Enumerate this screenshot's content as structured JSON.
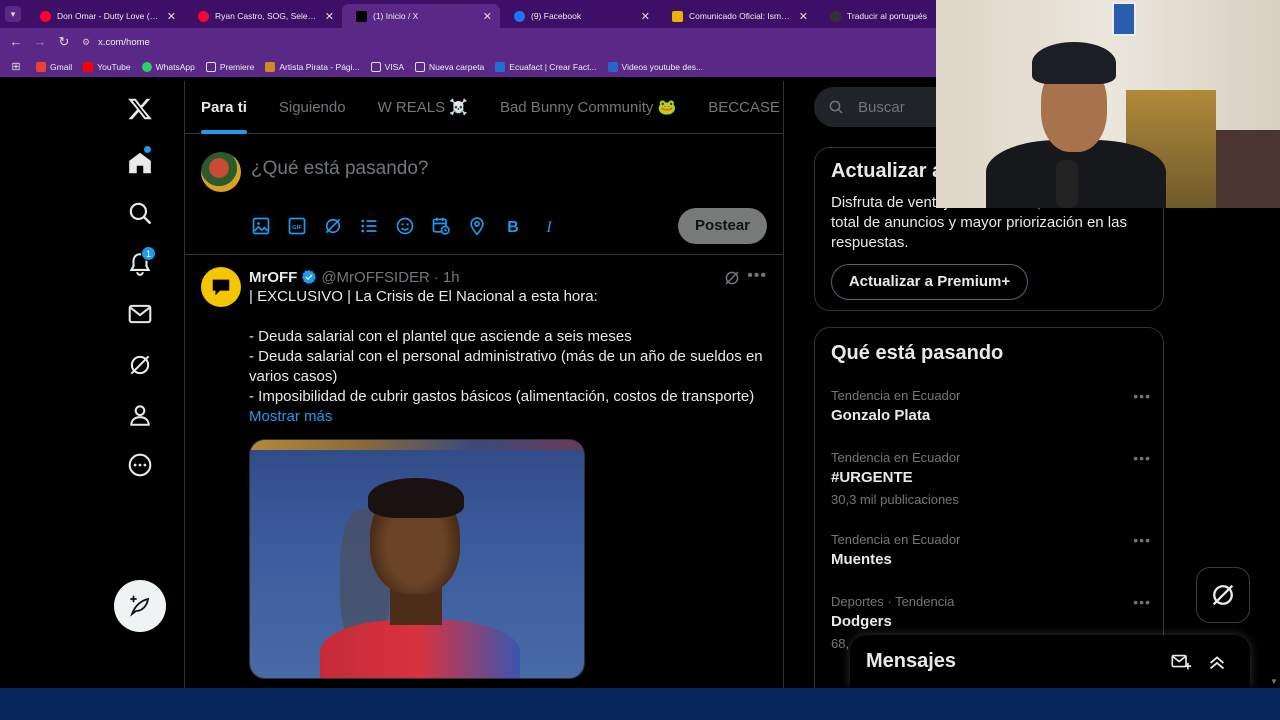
{
  "browser": {
    "tabs": [
      {
        "title": "Don Omar - Dutty Love (Lyric V",
        "favicon_color": "#ff0033",
        "active": false
      },
      {
        "title": "Ryan Castro, SOG, Selección Co",
        "favicon_color": "#ff0033",
        "active": false
      },
      {
        "title": "(1) Inicio / X",
        "favicon_color": "#000000",
        "active": true
      },
      {
        "title": "(9) Facebook",
        "favicon_color": "#1877f2",
        "active": false
      },
      {
        "title": "Comunicado Oficial: Ismael Re",
        "favicon_color": "#e8b400",
        "active": false
      },
      {
        "title": "Traducir al portugués",
        "favicon_color": "#333333",
        "active": false
      }
    ],
    "url": "x.com/home",
    "bookmarks": [
      {
        "label": "Gmail",
        "color": "#ea4335"
      },
      {
        "label": "YouTube",
        "color": "#ff0000"
      },
      {
        "label": "WhatsApp",
        "color": "#25d366"
      },
      {
        "label": "Premiere",
        "color": "#5a2987"
      },
      {
        "label": "Artista Pirata - Pági...",
        "color": "#d28a1e"
      },
      {
        "label": "VISA",
        "color": "#5a2987"
      },
      {
        "label": "Nueva carpeta",
        "color": "#5a2987"
      },
      {
        "label": "Ecuafact | Crear Fact...",
        "color": "#1f6fd1"
      },
      {
        "label": "Videos youtube des...",
        "color": "#2a64c8"
      }
    ]
  },
  "nav": {
    "notifications_badge": "1"
  },
  "feed_tabs": [
    "Para ti",
    "Siguiendo",
    "W REALS ☠️",
    "Bad Bunny Community 🐸",
    "BECCASE"
  ],
  "composer": {
    "placeholder": "¿Qué está pasando?",
    "post_label": "Postear"
  },
  "tweet": {
    "name": "MrOFF",
    "handle": "@MrOFFSIDER",
    "dot": "·",
    "time": "1h",
    "lines": [
      "| EXCLUSIVO | La Crisis de El Nacional a esta hora:",
      "",
      "- Deuda salarial con el plantel que asciende a seis meses",
      "- Deuda salarial con el personal administrativo (más de un año de sueldos en varios casos)",
      "- Imposibilidad de cubrir gastos básicos (alimentación, costos de transporte)"
    ],
    "show_more": "Mostrar más"
  },
  "search": {
    "placeholder": "Buscar"
  },
  "premium": {
    "title": "Actualizar a Premium",
    "text": "Disfruta de ventajas exclusivas, eliminación total de anuncios y mayor priorización en las respuestas.",
    "button": "Actualizar a Premium+"
  },
  "trends": {
    "title": "Qué está pasando",
    "items": [
      {
        "context": "Tendencia en Ecuador",
        "name": "Gonzalo Plata",
        "count": ""
      },
      {
        "context": "Tendencia en Ecuador",
        "name": "#URGENTE",
        "count": "30,3 mil publicaciones"
      },
      {
        "context": "Tendencia en Ecuador",
        "name": "Muentes",
        "count": ""
      },
      {
        "context": "Deportes · Tendencia",
        "name": "Dodgers",
        "count": "68,"
      }
    ]
  },
  "messages": {
    "title": "Mensajes"
  }
}
